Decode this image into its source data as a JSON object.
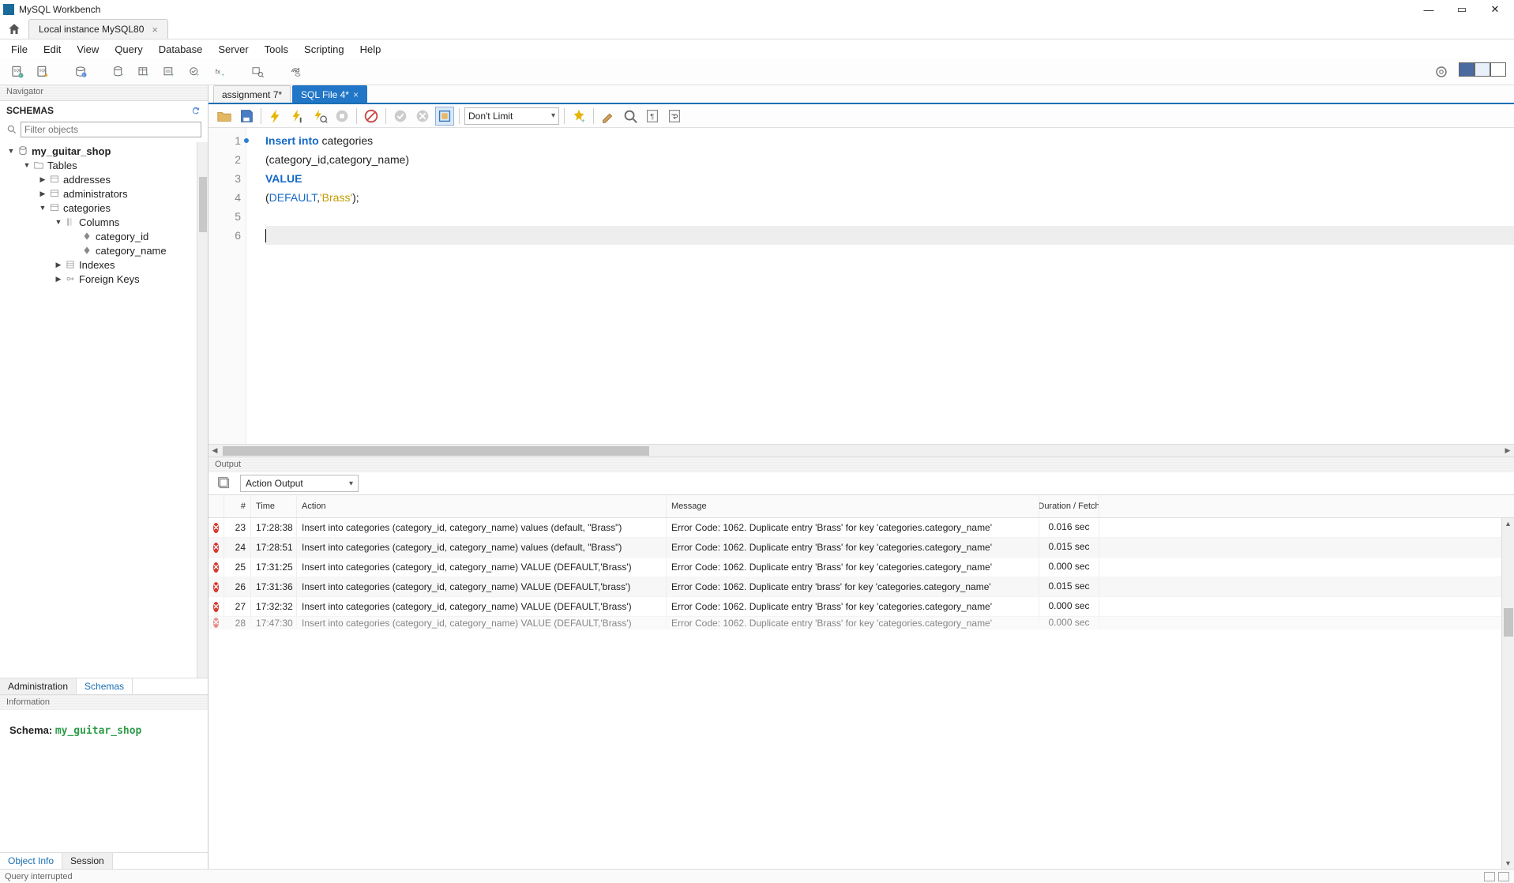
{
  "app": {
    "title": "MySQL Workbench"
  },
  "connection": {
    "tab": "Local instance MySQL80"
  },
  "menu": [
    "File",
    "Edit",
    "View",
    "Query",
    "Database",
    "Server",
    "Tools",
    "Scripting",
    "Help"
  ],
  "navigator": {
    "header": "Navigator",
    "schemas_label": "SCHEMAS",
    "filter_placeholder": "Filter objects",
    "tree": {
      "db": "my_guitar_shop",
      "tables_label": "Tables",
      "tables": [
        "addresses",
        "administrators"
      ],
      "open_table": "categories",
      "columns_label": "Columns",
      "columns": [
        "category_id",
        "category_name"
      ],
      "indexes_label": "Indexes",
      "fk_label": "Foreign Keys"
    },
    "tabs": {
      "admin": "Administration",
      "schemas": "Schemas"
    },
    "info_label": "Information",
    "info_prefix": "Schema: ",
    "info_schema": "my_guitar_shop",
    "bottom_tabs": {
      "obj": "Object Info",
      "sess": "Session"
    }
  },
  "editor_tabs": [
    {
      "label": "assignment 7*",
      "active": false
    },
    {
      "label": "SQL File 4*",
      "active": true
    }
  ],
  "sql_toolbar": {
    "limit": "Don't Limit"
  },
  "code": {
    "l1a": "Insert",
    "l1b": "into",
    "l1c": " categories",
    "l2": "(category_id,category_name)",
    "l3": "VALUE",
    "l4a": "(",
    "l4b": "DEFAULT",
    "l4c": ",",
    "l4d": "'Brass'",
    "l4e": ");"
  },
  "output": {
    "header": "Output",
    "selector": "Action Output",
    "columns": {
      "num": "#",
      "time": "Time",
      "action": "Action",
      "message": "Message",
      "duration": "Duration / Fetch"
    },
    "rows": [
      {
        "n": "23",
        "t": "17:28:38",
        "a": "Insert into categories (category_id, category_name) values (default, \"Brass\")",
        "m": "Error Code: 1062. Duplicate entry 'Brass' for key 'categories.category_name'",
        "d": "0.016 sec"
      },
      {
        "n": "24",
        "t": "17:28:51",
        "a": "Insert into categories (category_id, category_name) values (default, \"Brass\")",
        "m": "Error Code: 1062. Duplicate entry 'Brass' for key 'categories.category_name'",
        "d": "0.015 sec"
      },
      {
        "n": "25",
        "t": "17:31:25",
        "a": "Insert into categories (category_id, category_name) VALUE (DEFAULT,'Brass')",
        "m": "Error Code: 1062. Duplicate entry 'Brass' for key 'categories.category_name'",
        "d": "0.000 sec"
      },
      {
        "n": "26",
        "t": "17:31:36",
        "a": "Insert into categories (category_id, category_name) VALUE (DEFAULT,'brass')",
        "m": "Error Code: 1062. Duplicate entry 'brass' for key 'categories.category_name'",
        "d": "0.015 sec"
      },
      {
        "n": "27",
        "t": "17:32:32",
        "a": "Insert into categories (category_id, category_name) VALUE (DEFAULT,'Brass')",
        "m": "Error Code: 1062. Duplicate entry 'Brass' for key 'categories.category_name'",
        "d": "0.000 sec"
      },
      {
        "n": "28",
        "t": "17:47:30",
        "a": "Insert into categories (category_id, category_name) VALUE (DEFAULT,'Brass')",
        "m": "Error Code: 1062. Duplicate entry 'Brass' for key 'categories.category_name'",
        "d": "0.000 sec"
      }
    ]
  },
  "status": {
    "text": "Query interrupted"
  }
}
